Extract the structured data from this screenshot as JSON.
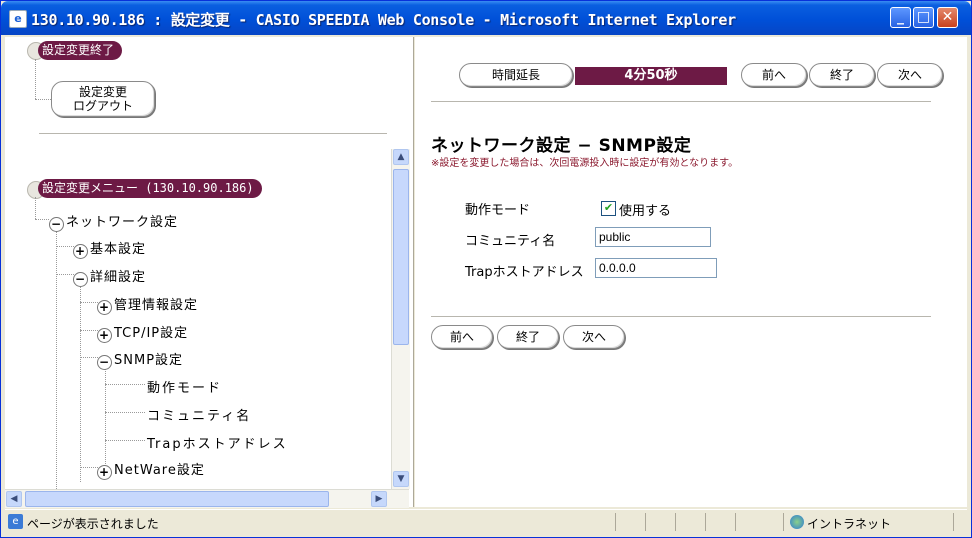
{
  "window": {
    "title": "130.10.90.186 : 設定変更 - CASIO SPEEDIA Web Console - Microsoft Internet Explorer",
    "minimize": "_",
    "maximize": "□",
    "close": "✕"
  },
  "left": {
    "end_pill": "設定変更終了",
    "logout_button_line1": "設定変更",
    "logout_button_line2": "ログアウト",
    "menu_pill": "設定変更メニュー (130.10.90.186)",
    "tree": {
      "network": "ネットワーク設定",
      "basic": "基本設定",
      "detail": "詳細設定",
      "mgmt": "管理情報設定",
      "tcpip": "TCP/IP設定",
      "snmp": "SNMP設定",
      "leaf_mode": "動作モード",
      "leaf_community": "コミュニティ名",
      "leaf_trap": "Trapホストアドレス",
      "netware": "NetWare設定"
    }
  },
  "right": {
    "extend_button": "時間延長",
    "timer": "4分50秒",
    "prev_button": "前へ",
    "end_button": "終了",
    "next_button": "次へ",
    "section_title": "ネットワーク設定 − SNMP設定",
    "note": "※設定を変更した場合は、次回電源投入時に設定が有効となります。",
    "mode_label": "動作モード",
    "mode_checkbox_label": "使用する",
    "mode_checked": true,
    "community_label": "コミュニティ名",
    "community_value": "public",
    "trap_label": "Trapホストアドレス",
    "trap_value": "0.0.0.0"
  },
  "statusbar": {
    "text": "ページが表示されました",
    "zone": "イントラネット"
  },
  "colors": {
    "pill": "#6d1a45",
    "titlebar": "#0050d8"
  }
}
